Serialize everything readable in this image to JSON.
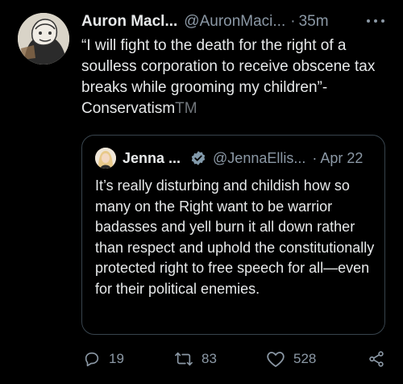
{
  "tweet": {
    "author_name": "Auron Macl...",
    "author_handle": "@AuronMaci...",
    "separator": "·",
    "time": "35m",
    "text": "“I will fight to the death for the right of a soulless corporation to receive obscene tax breaks while grooming my children”- Conservatism",
    "text_suffix": "TM",
    "more_icon": "more-horizontal-icon"
  },
  "quote": {
    "author_name": "Jenna ...",
    "verified_icon": "verified-badge-icon",
    "author_handle": "@JennaEllis...",
    "separator": "·",
    "date": "Apr 22",
    "text": "It’s really disturbing and childish how so many on the Right want to be warrior badasses and yell burn it all down rather than respect and uphold the constitutionally protected right to free speech for all—even for their political enemies."
  },
  "actions": {
    "reply_icon": "reply-icon",
    "reply_count": "19",
    "retweet_icon": "retweet-icon",
    "retweet_count": "83",
    "like_icon": "heart-icon",
    "like_count": "528",
    "share_icon": "share-icon"
  },
  "colors": {
    "background": "#000000",
    "text_primary": "#e7e9ea",
    "text_secondary": "#8b98a5",
    "border": "#38444d",
    "verified": "#829aab"
  }
}
